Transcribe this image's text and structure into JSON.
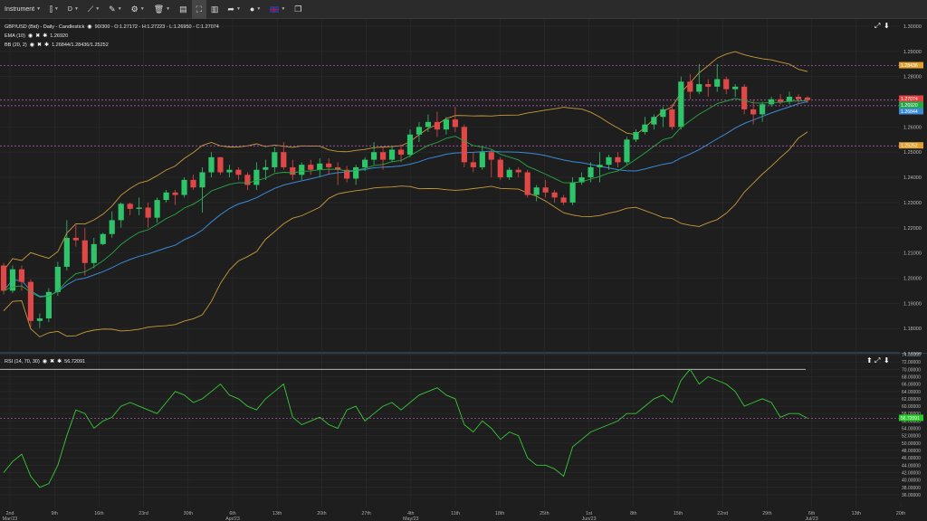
{
  "toolbar": {
    "instrument_label": "Instrument",
    "timeframe_label": "D"
  },
  "chart": {
    "legend_main": "GBP/USD (Bid) - Daily - Candlestick",
    "legend_main_values": "90/300 - O:1.27172 - H:1.27223 - L:1.26950 - C:1.27074",
    "ema_label": "EMA (10)",
    "ema_value": "1.26920",
    "bb_label": "BB (20, 2)",
    "bb_value": "1.26844/1.28436/1.25252",
    "rsi_label": "RSI (14, 70, 30)",
    "rsi_value": "56.72091"
  },
  "price_axis": {
    "labels": [
      "1.30000",
      "1.29000",
      "1.28000",
      "1.27000",
      "1.26000",
      "1.25000",
      "1.24000",
      "1.23000",
      "1.22000",
      "1.21000",
      "1.20000",
      "1.19000",
      "1.18000",
      "1.17000"
    ],
    "tags": [
      {
        "text": "1.28436",
        "color": "#e0a030"
      },
      {
        "text": "1.27074",
        "color": "#e04040"
      },
      {
        "text": "1.26920",
        "color": "#22aa44"
      },
      {
        "text": "1.26844",
        "color": "#3a8ad6"
      },
      {
        "text": "1.25252",
        "color": "#e0a030"
      }
    ]
  },
  "rsi_axis": {
    "labels": [
      "74.00000",
      "72.00000",
      "70.00000",
      "68.00000",
      "66.00000",
      "64.00000",
      "62.00000",
      "60.00000",
      "58.00000",
      "56.00000",
      "54.00000",
      "52.00000",
      "50.00000",
      "48.00000",
      "46.00000",
      "44.00000",
      "42.00000",
      "40.00000",
      "38.00000",
      "36.00000"
    ],
    "tag": {
      "text": "56.72091",
      "color": "#22cc22"
    }
  },
  "date_axis": {
    "labels": [
      {
        "top": "2nd",
        "bottom": "Mar/23"
      },
      {
        "top": "9th",
        "bottom": ""
      },
      {
        "top": "16th",
        "bottom": ""
      },
      {
        "top": "23rd",
        "bottom": ""
      },
      {
        "top": "30th",
        "bottom": ""
      },
      {
        "top": "6th",
        "bottom": "Apr/23"
      },
      {
        "top": "13th",
        "bottom": ""
      },
      {
        "top": "20th",
        "bottom": ""
      },
      {
        "top": "27th",
        "bottom": ""
      },
      {
        "top": "4th",
        "bottom": "May/23"
      },
      {
        "top": "11th",
        "bottom": ""
      },
      {
        "top": "18th",
        "bottom": ""
      },
      {
        "top": "25th",
        "bottom": ""
      },
      {
        "top": "1st",
        "bottom": "Jun/23"
      },
      {
        "top": "8th",
        "bottom": ""
      },
      {
        "top": "15th",
        "bottom": ""
      },
      {
        "top": "22nd",
        "bottom": ""
      },
      {
        "top": "29th",
        "bottom": ""
      },
      {
        "top": "6th",
        "bottom": "Jul/23"
      },
      {
        "top": "13th",
        "bottom": ""
      },
      {
        "top": "20th",
        "bottom": ""
      }
    ]
  },
  "colors": {
    "up": "#2ec46a",
    "down": "#e04848",
    "ema": "#28a845",
    "bb_mid": "#3a8ad6",
    "bb_band": "#c89a3a",
    "rsi": "#37c837",
    "dashed": "#c060c0"
  },
  "chart_data": [
    {
      "type": "candlestick",
      "title": "GBP/USD (Bid) - Daily - Candlestick",
      "ylim": [
        1.17,
        1.3
      ],
      "x": [
        "02 Mar",
        "03 Mar",
        "06 Mar",
        "07 Mar",
        "08 Mar",
        "09 Mar",
        "10 Mar",
        "13 Mar",
        "14 Mar",
        "15 Mar",
        "16 Mar",
        "17 Mar",
        "20 Mar",
        "21 Mar",
        "22 Mar",
        "23 Mar",
        "24 Mar",
        "27 Mar",
        "28 Mar",
        "29 Mar",
        "30 Mar",
        "31 Mar",
        "03 Apr",
        "04 Apr",
        "05 Apr",
        "06 Apr",
        "07 Apr",
        "10 Apr",
        "11 Apr",
        "12 Apr",
        "13 Apr",
        "14 Apr",
        "17 Apr",
        "18 Apr",
        "19 Apr",
        "20 Apr",
        "21 Apr",
        "24 Apr",
        "25 Apr",
        "26 Apr",
        "27 Apr",
        "28 Apr",
        "01 May",
        "02 May",
        "03 May",
        "04 May",
        "05 May",
        "08 May",
        "09 May",
        "10 May",
        "11 May",
        "12 May",
        "15 May",
        "16 May",
        "17 May",
        "18 May",
        "19 May",
        "22 May",
        "23 May",
        "24 May",
        "25 May",
        "26 May",
        "29 May",
        "30 May",
        "31 May",
        "01 Jun",
        "02 Jun",
        "05 Jun",
        "06 Jun",
        "07 Jun",
        "08 Jun",
        "09 Jun",
        "12 Jun",
        "13 Jun",
        "14 Jun",
        "15 Jun",
        "16 Jun",
        "19 Jun",
        "20 Jun",
        "21 Jun",
        "22 Jun",
        "23 Jun",
        "26 Jun",
        "27 Jun",
        "28 Jun",
        "29 Jun",
        "30 Jun",
        "03 Jul",
        "04 Jul",
        "05 Jul"
      ],
      "series": [
        {
          "name": "GBP/USD",
          "ohlc": [
            [
              1.205,
              1.206,
              1.1935,
              1.195
            ],
            [
              1.195,
              1.205,
              1.194,
              1.2035
            ],
            [
              1.2035,
              1.205,
              1.195,
              1.1985
            ],
            [
              1.1985,
              1.1995,
              1.1805,
              1.183
            ],
            [
              1.183,
              1.186,
              1.1802,
              1.184
            ],
            [
              1.184,
              1.196,
              1.1825,
              1.1945
            ],
            [
              1.1945,
              1.2065,
              1.193,
              1.2045
            ],
            [
              1.2045,
              1.223,
              1.203,
              1.216
            ],
            [
              1.216,
              1.221,
              1.2125,
              1.215
            ],
            [
              1.215,
              1.22,
              1.201,
              1.206
            ],
            [
              1.206,
              1.216,
              1.204,
              1.2135
            ],
            [
              1.2135,
              1.218,
              1.213,
              1.2175
            ],
            [
              1.2175,
              1.2265,
              1.216,
              1.223
            ],
            [
              1.223,
              1.23,
              1.22,
              1.2295
            ],
            [
              1.2295,
              1.23,
              1.225,
              1.2275
            ],
            [
              1.2275,
              1.232,
              1.225,
              1.228
            ],
            [
              1.228,
              1.23,
              1.22,
              1.224
            ],
            [
              1.224,
              1.232,
              1.222,
              1.231
            ],
            [
              1.231,
              1.235,
              1.23,
              1.234
            ],
            [
              1.234,
              1.235,
              1.229,
              1.233
            ],
            [
              1.233,
              1.24,
              1.232,
              1.239
            ],
            [
              1.239,
              1.241,
              1.235,
              1.236
            ],
            [
              1.236,
              1.244,
              1.226,
              1.242
            ],
            [
              1.242,
              1.25,
              1.24,
              1.248
            ],
            [
              1.248,
              1.248,
              1.241,
              1.242
            ],
            [
              1.242,
              1.245,
              1.24,
              1.243
            ],
            [
              1.243,
              1.244,
              1.239,
              1.241
            ],
            [
              1.241,
              1.242,
              1.235,
              1.237
            ],
            [
              1.237,
              1.246,
              1.235,
              1.243
            ],
            [
              1.243,
              1.247,
              1.239,
              1.244
            ],
            [
              1.244,
              1.252,
              1.242,
              1.25
            ],
            [
              1.25,
              1.254,
              1.243,
              1.244
            ],
            [
              1.244,
              1.247,
              1.239,
              1.241
            ],
            [
              1.241,
              1.246,
              1.239,
              1.245
            ],
            [
              1.245,
              1.247,
              1.241,
              1.243
            ],
            [
              1.243,
              1.2475,
              1.24,
              1.2455
            ],
            [
              1.2455,
              1.2475,
              1.241,
              1.244
            ],
            [
              1.244,
              1.246,
              1.237,
              1.243
            ],
            [
              1.243,
              1.2445,
              1.238,
              1.2395
            ],
            [
              1.2395,
              1.245,
              1.237,
              1.244
            ],
            [
              1.244,
              1.248,
              1.2425,
              1.247
            ],
            [
              1.247,
              1.254,
              1.245,
              1.25
            ],
            [
              1.25,
              1.252,
              1.243,
              1.247
            ],
            [
              1.247,
              1.252,
              1.246,
              1.251
            ],
            [
              1.251,
              1.253,
              1.246,
              1.249
            ],
            [
              1.249,
              1.259,
              1.248,
              1.257
            ],
            [
              1.257,
              1.262,
              1.254,
              1.26
            ],
            [
              1.26,
              1.265,
              1.258,
              1.262
            ],
            [
              1.262,
              1.266,
              1.256,
              1.259
            ],
            [
              1.259,
              1.264,
              1.257,
              1.263
            ],
            [
              1.263,
              1.268,
              1.258,
              1.26
            ],
            [
              1.26,
              1.261,
              1.244,
              1.246
            ],
            [
              1.246,
              1.25,
              1.242,
              1.244
            ],
            [
              1.244,
              1.252,
              1.243,
              1.25
            ],
            [
              1.25,
              1.251,
              1.24,
              1.247
            ],
            [
              1.247,
              1.248,
              1.239,
              1.24
            ],
            [
              1.24,
              1.244,
              1.239,
              1.243
            ],
            [
              1.243,
              1.244,
              1.24,
              1.242
            ],
            [
              1.242,
              1.243,
              1.232,
              1.233
            ],
            [
              1.233,
              1.237,
              1.2305,
              1.236
            ],
            [
              1.236,
              1.239,
              1.232,
              1.234
            ],
            [
              1.234,
              1.235,
              1.23,
              1.232
            ],
            [
              1.232,
              1.233,
              1.229,
              1.23
            ],
            [
              1.23,
              1.24,
              1.229,
              1.238
            ],
            [
              1.238,
              1.242,
              1.237,
              1.24
            ],
            [
              1.24,
              1.246,
              1.238,
              1.244
            ],
            [
              1.244,
              1.25,
              1.238,
              1.245
            ],
            [
              1.245,
              1.249,
              1.243,
              1.248
            ],
            [
              1.248,
              1.25,
              1.244,
              1.246
            ],
            [
              1.246,
              1.256,
              1.245,
              1.255
            ],
            [
              1.255,
              1.259,
              1.254,
              1.258
            ],
            [
              1.258,
              1.264,
              1.257,
              1.261
            ],
            [
              1.261,
              1.265,
              1.259,
              1.264
            ],
            [
              1.264,
              1.268,
              1.26,
              1.267
            ],
            [
              1.267,
              1.269,
              1.259,
              1.26
            ],
            [
              1.26,
              1.28,
              1.259,
              1.278
            ],
            [
              1.278,
              1.281,
              1.271,
              1.274
            ],
            [
              1.274,
              1.285,
              1.273,
              1.277
            ],
            [
              1.277,
              1.279,
              1.272,
              1.276
            ],
            [
              1.276,
              1.285,
              1.274,
              1.279
            ],
            [
              1.279,
              1.28,
              1.273,
              1.275
            ],
            [
              1.275,
              1.277,
              1.272,
              1.276
            ],
            [
              1.276,
              1.277,
              1.265,
              1.267
            ],
            [
              1.267,
              1.271,
              1.261,
              1.265
            ],
            [
              1.265,
              1.27,
              1.262,
              1.269
            ],
            [
              1.269,
              1.272,
              1.268,
              1.271
            ],
            [
              1.271,
              1.273,
              1.269,
              1.27
            ],
            [
              1.27,
              1.274,
              1.269,
              1.272
            ],
            [
              1.272,
              1.273,
              1.269,
              1.271
            ],
            [
              1.2717,
              1.2722,
              1.2695,
              1.2707
            ]
          ]
        }
      ]
    },
    {
      "type": "line",
      "title": "RSI (14, 70, 30)",
      "ylim": [
        35,
        74
      ],
      "series": [
        {
          "name": "RSI (14, 70, 30)",
          "values": [
            42,
            45,
            47,
            41,
            38,
            39,
            44,
            52,
            59,
            58,
            54,
            56,
            57,
            60,
            61,
            60,
            59,
            58,
            61,
            64,
            63,
            61,
            62,
            64,
            66,
            63,
            62,
            60,
            59,
            62,
            64,
            66,
            57,
            55,
            56,
            57,
            55,
            54,
            59,
            60,
            56,
            58,
            60,
            61,
            59,
            61,
            63,
            64,
            65,
            63,
            62,
            55,
            53,
            56,
            54,
            51,
            53,
            52,
            46,
            44,
            44,
            43,
            41,
            49,
            51,
            53,
            54,
            55,
            56,
            58,
            58,
            60,
            62,
            63,
            61,
            67,
            70,
            66,
            68,
            67,
            66,
            64,
            60,
            61,
            62,
            61,
            57,
            58,
            58,
            56.72
          ]
        }
      ]
    }
  ]
}
